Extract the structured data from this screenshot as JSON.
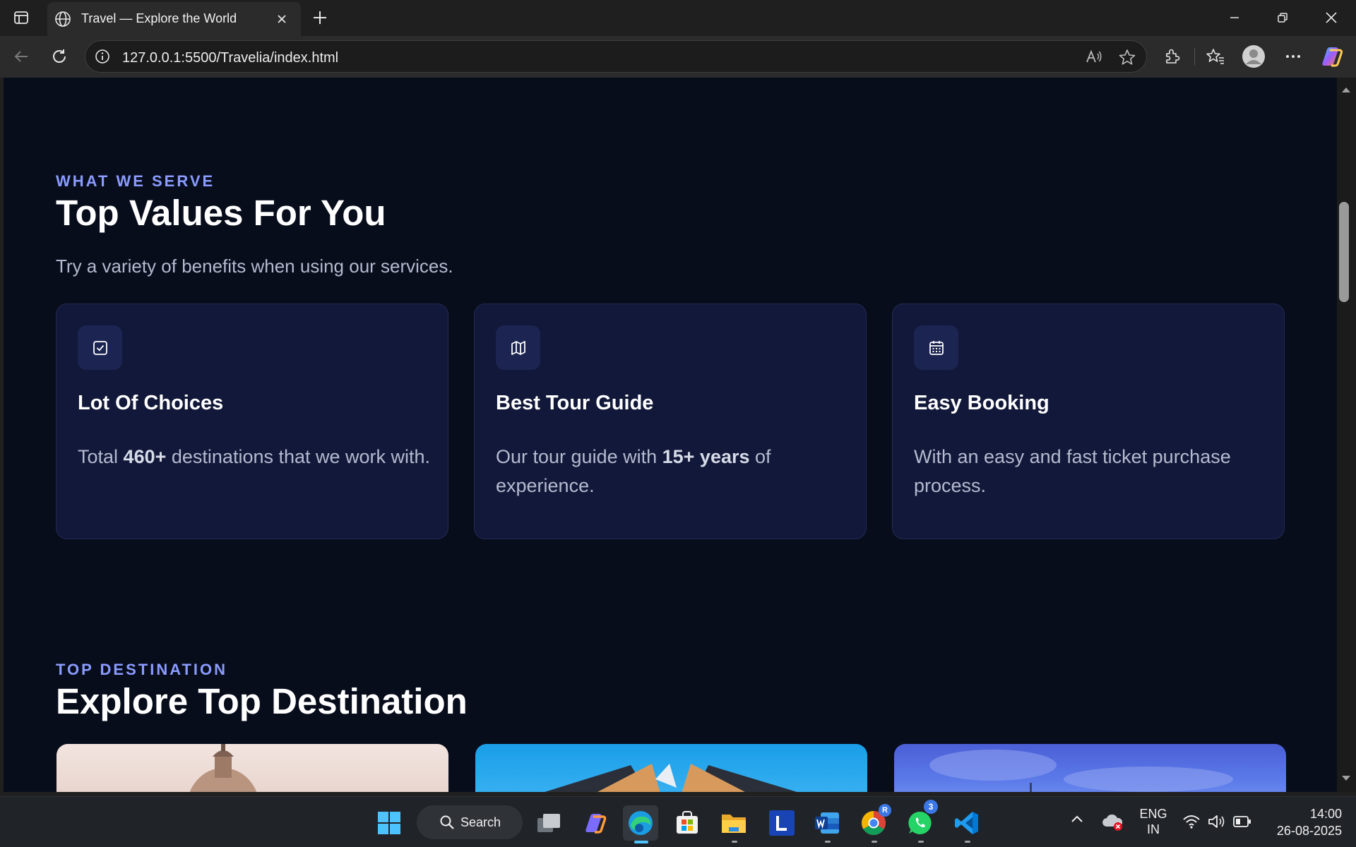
{
  "browser": {
    "tab_title": "Travel — Explore the World",
    "url": "127.0.0.1:5500/Travelia/index.html"
  },
  "page": {
    "values_section": {
      "eyebrow": "WHAT WE SERVE",
      "heading": "Top Values For You",
      "subtext": "Try a variety of benefits when using our services.",
      "cards": [
        {
          "icon": "checkbox-icon",
          "title": "Lot Of Choices",
          "desc_before": "Total ",
          "desc_bold": "460+",
          "desc_after": " destinations that we work with."
        },
        {
          "icon": "map-icon",
          "title": "Best Tour Guide",
          "desc_before": "Our tour guide with ",
          "desc_bold": "15+ years",
          "desc_after": " of experience."
        },
        {
          "icon": "calendar-icon",
          "title": "Easy Booking",
          "desc_before": "With an easy and fast ticket purchase process.",
          "desc_bold": "",
          "desc_after": ""
        }
      ]
    },
    "destination_section": {
      "eyebrow": "TOP DESTINATION",
      "heading": "Explore Top Destination"
    }
  },
  "taskbar": {
    "search_label": "Search",
    "language_line1": "ENG",
    "language_line2": "IN",
    "time": "14:00",
    "date": "26-08-2025",
    "chrome_badge": "R",
    "whatsapp_badge": "3"
  },
  "colors": {
    "page_bg": "#080d1c",
    "card_bg": "#121839",
    "accent": "#8b9cff"
  }
}
